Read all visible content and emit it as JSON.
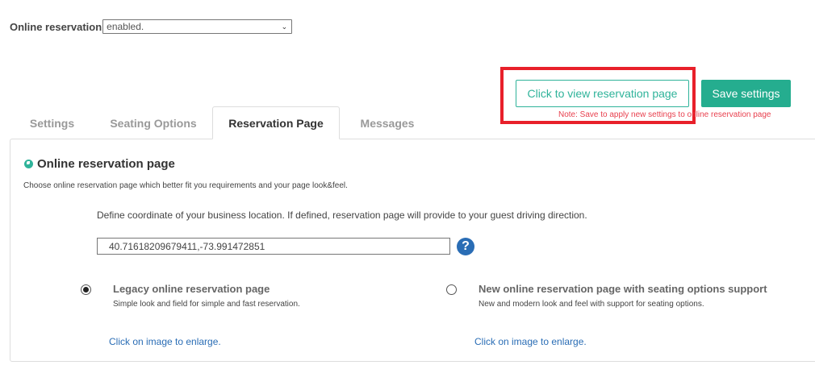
{
  "top": {
    "label": "Online reservation",
    "select_value": "enabled."
  },
  "actions": {
    "view_page_label": "Click to view reservation page",
    "save_label": "Save settings",
    "note": "Note: Save to apply new settings to online reservation page"
  },
  "tabs": [
    {
      "label": "Settings"
    },
    {
      "label": "Seating Options"
    },
    {
      "label": "Reservation Page"
    },
    {
      "label": "Messages"
    }
  ],
  "panel": {
    "title": "Online reservation page",
    "description": "Choose online reservation page which better fit you requirements and your page look&feel.",
    "coordinate_description": "Define coordinate of your business location. If defined, reservation page will provide to your guest driving direction.",
    "coordinate_value": "40.71618209679411,-73.991472851",
    "help_symbol": "?"
  },
  "options": [
    {
      "title": "Legacy online reservation page",
      "description": "Simple look and field for simple and fast reservation.",
      "enlarge_link": "Click on image to enlarge.",
      "selected": true
    },
    {
      "title": "New online reservation page with seating options support",
      "description": "New and modern look and feel with support for seating options.",
      "enlarge_link": "Click on image to enlarge.",
      "selected": false
    }
  ],
  "colors": {
    "accent": "#25ad8f",
    "highlight": "#e8202a",
    "link": "#2a6db5",
    "note": "#e8404e"
  }
}
